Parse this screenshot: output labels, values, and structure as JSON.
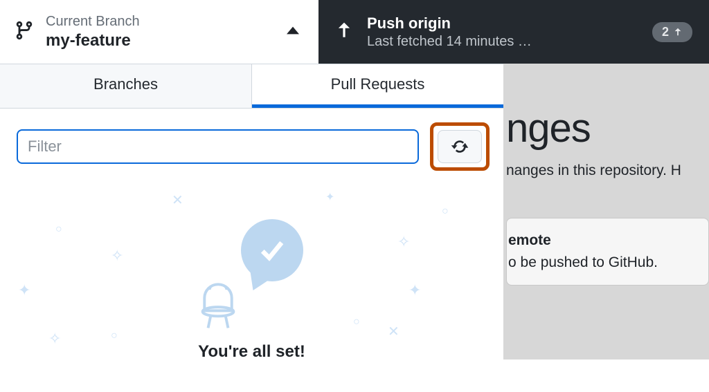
{
  "toolbar": {
    "branch_label": "Current Branch",
    "branch_name": "my-feature",
    "push_title": "Push origin",
    "push_subtitle": "Last fetched 14 minutes …",
    "push_badge_count": "2"
  },
  "tabs": {
    "branches": "Branches",
    "pull_requests": "Pull Requests"
  },
  "filter": {
    "placeholder": "Filter"
  },
  "empty": {
    "title": "You're all set!"
  },
  "background": {
    "heading": "nges",
    "line": "nanges in this repository. H",
    "card_title": "emote",
    "card_sub": "o be pushed to GitHub."
  }
}
